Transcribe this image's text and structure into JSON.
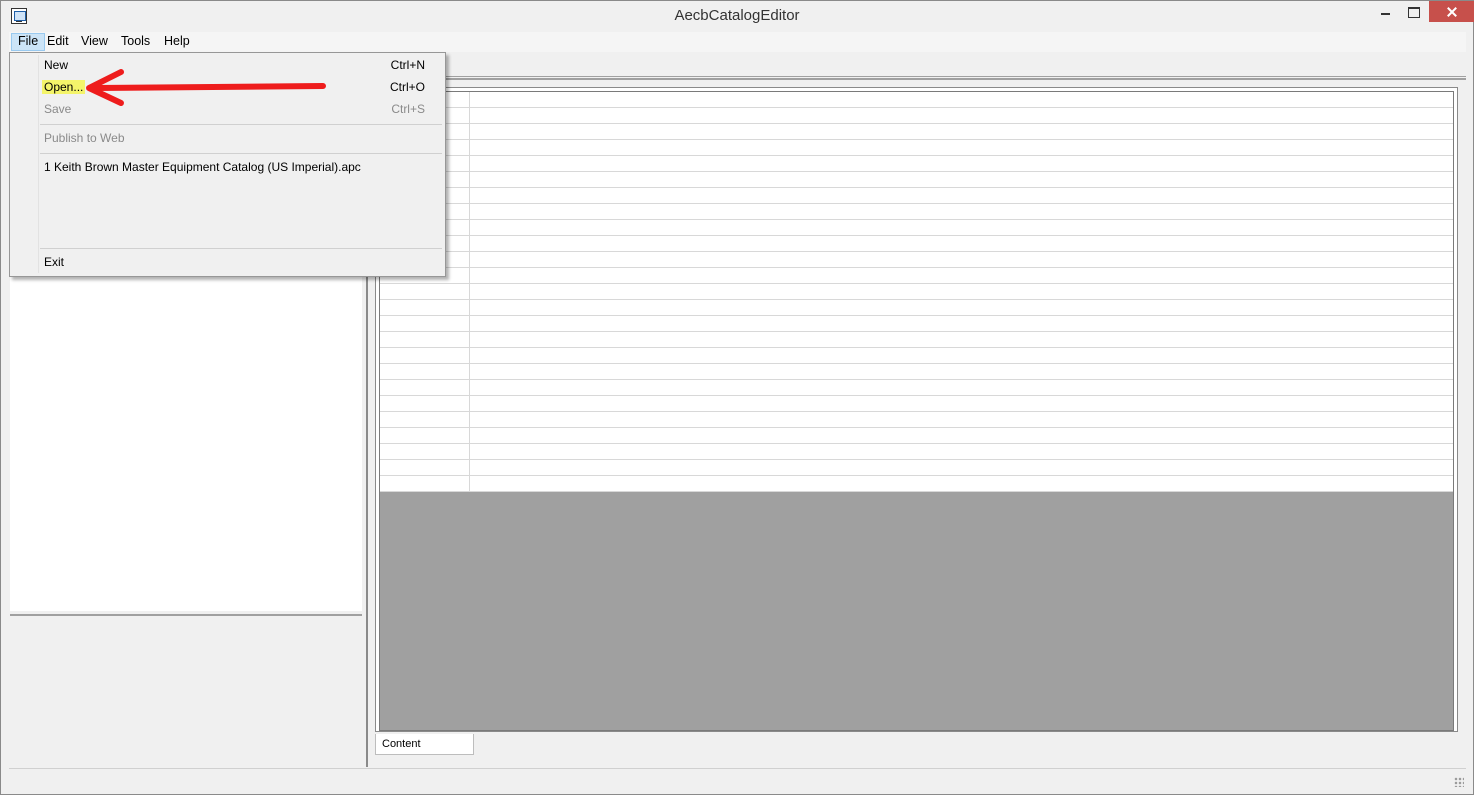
{
  "window": {
    "title": "AecbCatalogEditor"
  },
  "menubar": {
    "items": [
      "File",
      "Edit",
      "View",
      "Tools",
      "Help"
    ]
  },
  "file_menu": {
    "new": {
      "label": "New",
      "shortcut": "Ctrl+N"
    },
    "open": {
      "label": "Open...",
      "shortcut": "Ctrl+O"
    },
    "save": {
      "label": "Save",
      "shortcut": "Ctrl+S"
    },
    "publish": {
      "label": "Publish to Web"
    },
    "recent": "1 Keith Brown Master Equipment Catalog (US Imperial).apc",
    "exit": {
      "label": "Exit"
    }
  },
  "content_tab": {
    "label": "Content"
  },
  "annotation": {
    "arrow_color": "#ee1c1c",
    "highlight_color": "#f4f46a"
  }
}
